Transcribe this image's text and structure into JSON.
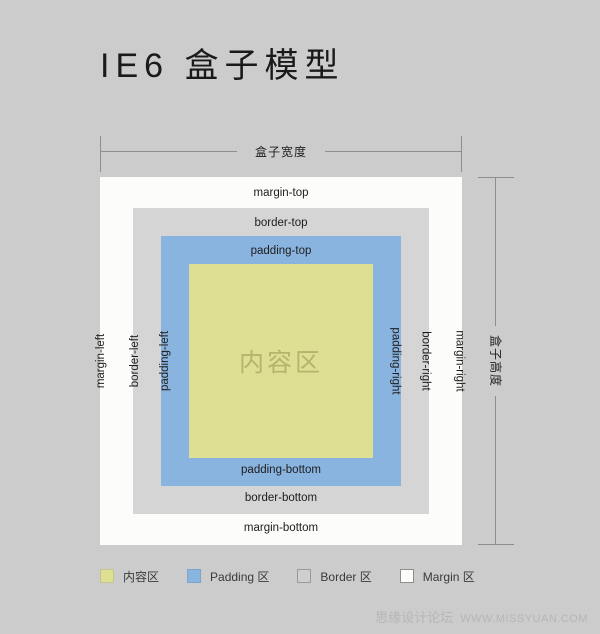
{
  "page": {
    "title": "IE6 盒子模型",
    "background_color": "#cccccc"
  },
  "dimensions": {
    "width_label": "盒子宽度",
    "height_label": "盒子高度"
  },
  "box_model": {
    "margin": {
      "top": "margin-top",
      "right": "margin-right",
      "bottom": "margin-bottom",
      "left": "margin-left",
      "color": "#fcfdfa"
    },
    "border": {
      "top": "border-top",
      "right": "border-right",
      "bottom": "border-bottom",
      "left": "border-left",
      "color": "#d5d5d5"
    },
    "padding": {
      "top": "padding-top",
      "right": "padding-right",
      "bottom": "padding-bottom",
      "left": "padding-left",
      "color": "#8ab4e0"
    },
    "content": {
      "label": "内容区",
      "color": "#dfdf93"
    }
  },
  "legend": {
    "items": [
      {
        "label": "内容区",
        "color": "#dfdf93",
        "swatch": "sw-content"
      },
      {
        "label": "Padding 区",
        "color": "#8ab4e0",
        "swatch": "sw-padding"
      },
      {
        "label": "Border 区",
        "color": "#cfcfcf",
        "swatch": "sw-border"
      },
      {
        "label": "Margin 区",
        "color": "#fdfdfa",
        "swatch": "sw-margin"
      }
    ]
  },
  "footer": {
    "brand": "思缘设计论坛",
    "url": "WWW.MISSYUAN.COM"
  }
}
